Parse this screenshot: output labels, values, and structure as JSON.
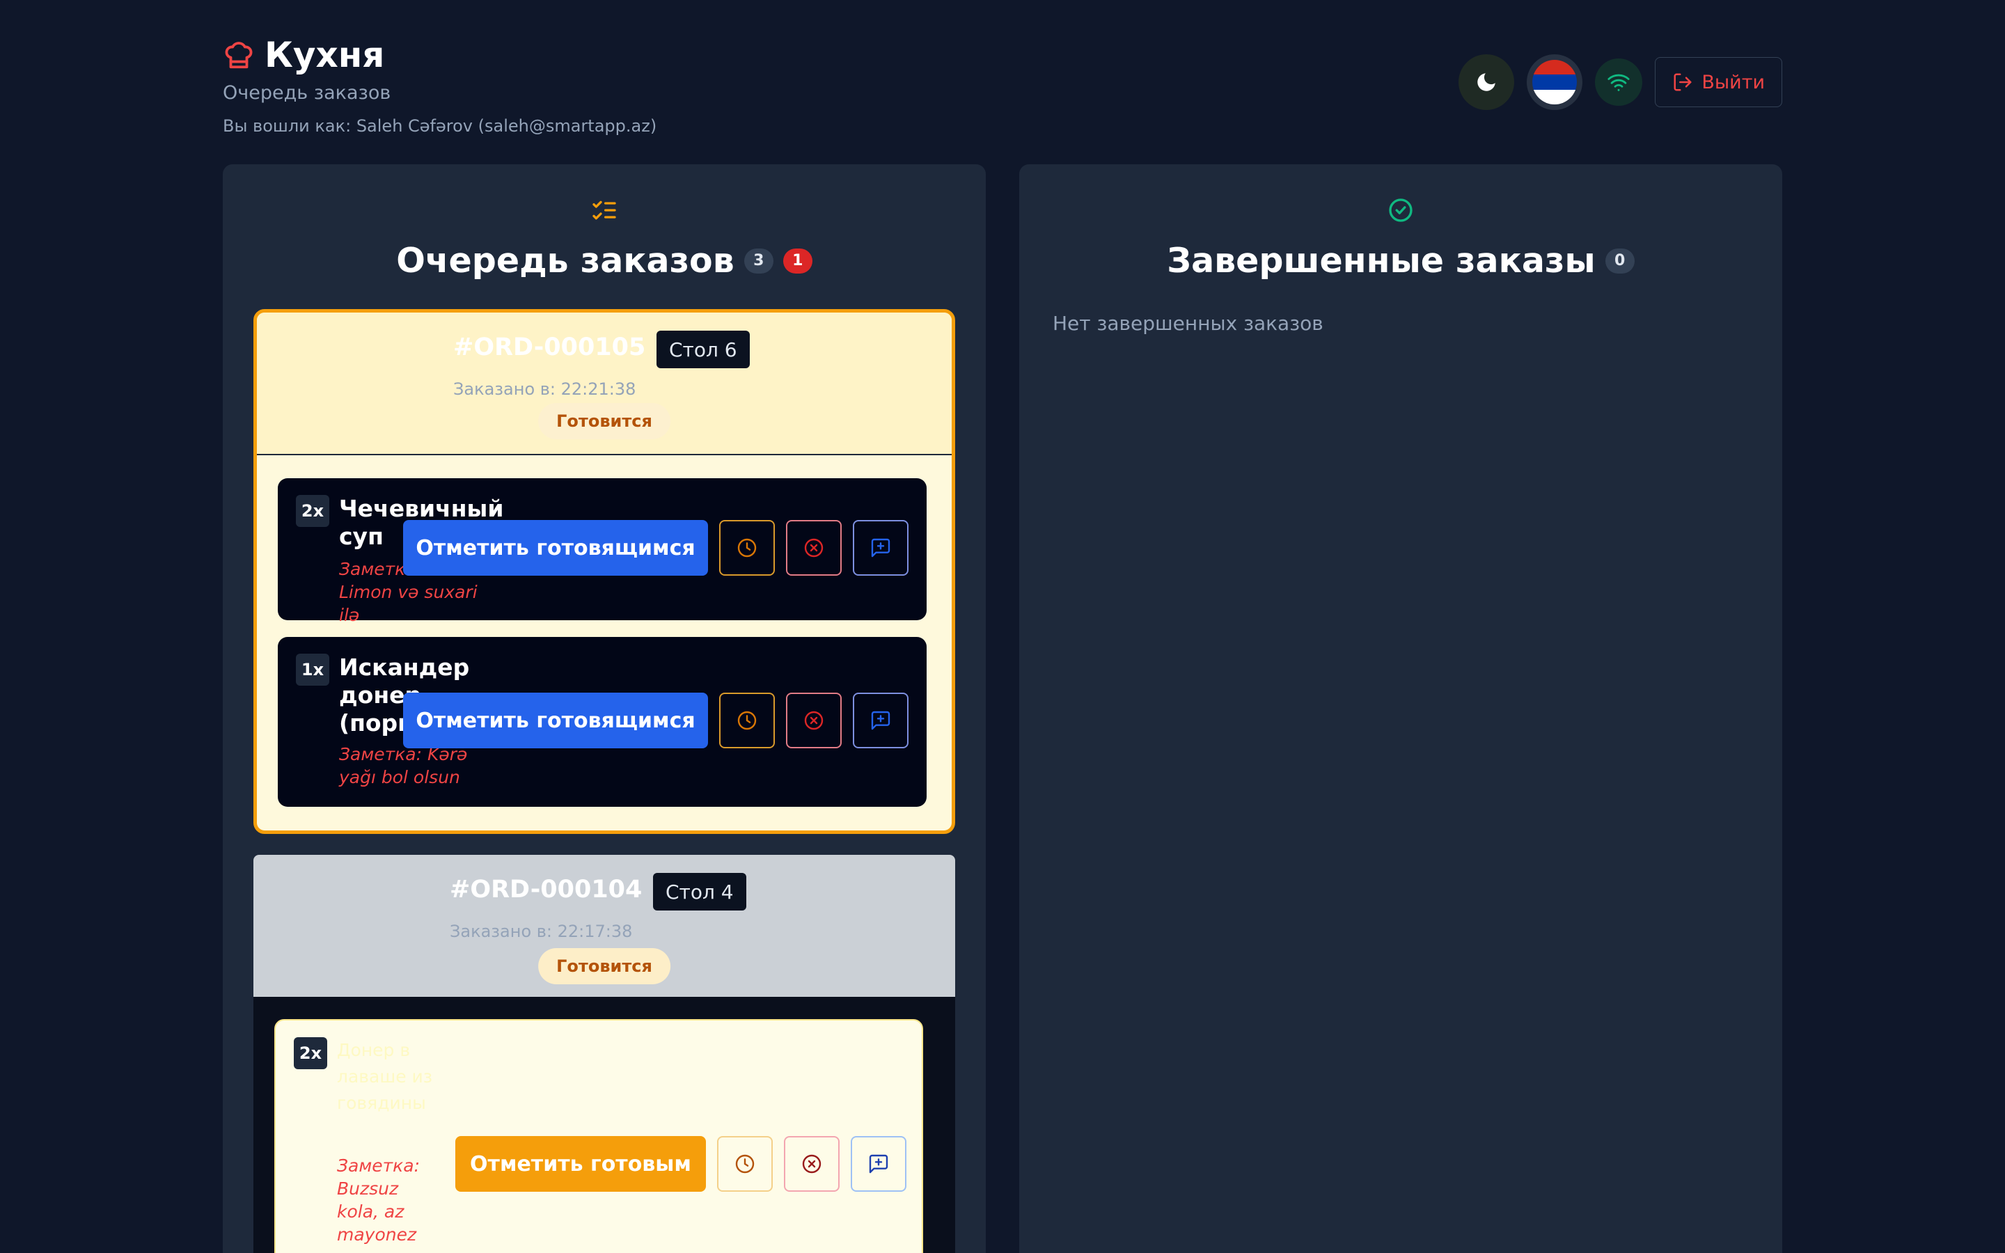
{
  "header": {
    "title": "Кухня",
    "subtitle": "Очередь заказов",
    "logged_in": "Вы вошли как: Saleh Cəfərov (saleh@smartapp.az)",
    "logout_label": "Выйти",
    "icons": {
      "brand": "chef-hat-icon",
      "theme": "moon-icon",
      "language": "flag-icon",
      "connection": "wifi-icon",
      "logout": "logout-icon"
    }
  },
  "queue": {
    "title": "Очередь заказов",
    "count": "3",
    "urgent_count": "1",
    "icon": "list-checks-icon",
    "orders": [
      {
        "number": "#ORD-000105",
        "table": "Стол 6",
        "ordered_at": "Заказано в: 22:21:38",
        "status": "Готовится",
        "items": [
          {
            "qty": "2x",
            "name": "Чечевичный суп",
            "note": "Заметка: Limon və suxari ilə",
            "action": "Отметить готовящимся"
          },
          {
            "qty": "1x",
            "name": "Искандер донер (порция)",
            "note": "Заметка: Kərə yağı bol olsun",
            "action": "Отметить готовящимся"
          }
        ]
      },
      {
        "number": "#ORD-000104",
        "table": "Стол 4",
        "ordered_at": "Заказано в: 22:17:38",
        "status": "Готовится",
        "items": [
          {
            "qty": "2x",
            "name": "Донер в лаваше из говядины",
            "note": "Заметка: Buzsuz kola, az mayonez",
            "action": "Отметить готовым"
          }
        ]
      }
    ]
  },
  "completed": {
    "title": "Завершенные заказы",
    "count": "0",
    "empty": "Нет завершенных заказов",
    "icon": "check-circle-icon"
  },
  "colors": {
    "background": "#0f172a",
    "panel": "#1e293b",
    "accent_amber": "#f59e0b",
    "accent_blue": "#2563eb",
    "danger": "#ef4444",
    "success": "#10b981"
  }
}
